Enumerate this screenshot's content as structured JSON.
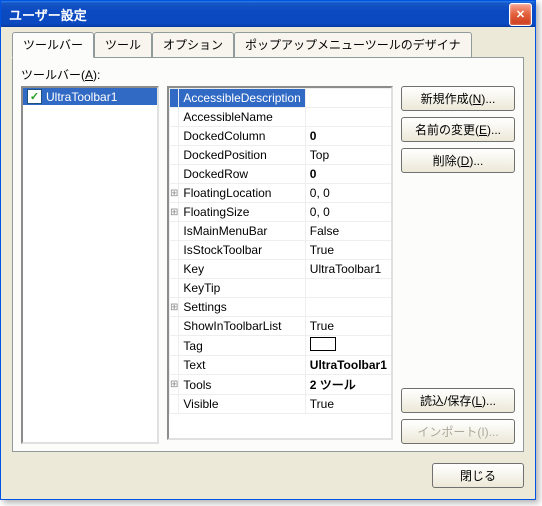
{
  "window": {
    "title": "ユーザー設定",
    "close_label": "✕"
  },
  "tabs": [
    {
      "label": "ツールバー",
      "active": true
    },
    {
      "label": "ツール"
    },
    {
      "label": "オプション"
    },
    {
      "label": "ポップアップメニューツールのデザイナ"
    }
  ],
  "toolbars_label_prefix": "ツールバー(",
  "toolbars_label_key": "A",
  "toolbars_label_suffix": "):",
  "toolbars": [
    {
      "name": "UltraToolbar1",
      "checked": true,
      "selected": true
    }
  ],
  "properties": [
    {
      "name": "AccessibleDescription",
      "value": "",
      "selected": true
    },
    {
      "name": "AccessibleName",
      "value": ""
    },
    {
      "name": "DockedColumn",
      "value": "0",
      "bold": true
    },
    {
      "name": "DockedPosition",
      "value": "Top"
    },
    {
      "name": "DockedRow",
      "value": "0",
      "bold": true
    },
    {
      "name": "FloatingLocation",
      "value": "0, 0",
      "expand": "+"
    },
    {
      "name": "FloatingSize",
      "value": "0, 0",
      "expand": "+"
    },
    {
      "name": "IsMainMenuBar",
      "value": "False"
    },
    {
      "name": "IsStockToolbar",
      "value": "True"
    },
    {
      "name": "Key",
      "value": "UltraToolbar1"
    },
    {
      "name": "KeyTip",
      "value": ""
    },
    {
      "name": "Settings",
      "value": "",
      "expand": "+"
    },
    {
      "name": "ShowInToolbarList",
      "value": "True"
    },
    {
      "name": "Tag",
      "value": "__TAG__"
    },
    {
      "name": "Text",
      "value": "UltraToolbar1",
      "bold": true
    },
    {
      "name": "Tools",
      "value": "2 ツール",
      "bold": true,
      "expand": "+"
    },
    {
      "name": "Visible",
      "value": "True"
    }
  ],
  "buttons": {
    "new": {
      "pre": "新規作成(",
      "key": "N",
      "post": ")..."
    },
    "rename": {
      "pre": "名前の変更(",
      "key": "E",
      "post": ")..."
    },
    "delete": {
      "pre": "削除(",
      "key": "D",
      "post": ")..."
    },
    "loadsave": {
      "pre": "読込/保存(",
      "key": "L",
      "post": ")..."
    },
    "import": {
      "pre": "インポート(",
      "key": "I",
      "post": ")..."
    },
    "close": "閉じる"
  }
}
